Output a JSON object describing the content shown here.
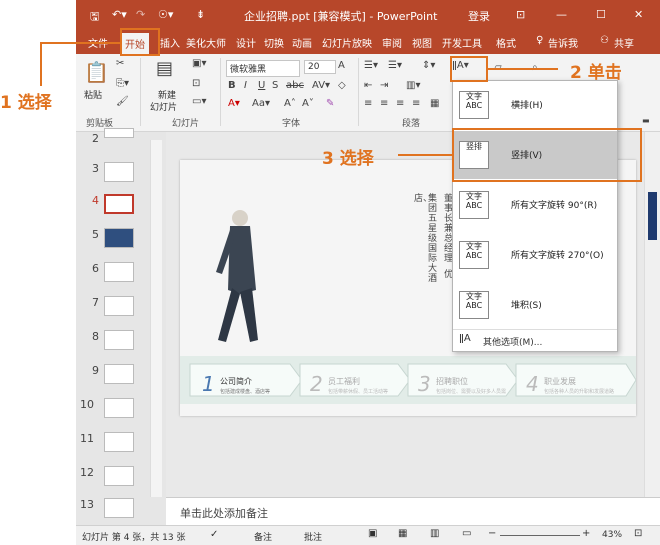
{
  "app": {
    "title": "企业招聘.ppt [兼容模式] - PowerPoint",
    "login": "登录"
  },
  "menu": {
    "tabs": [
      "文件",
      "开始",
      "插入",
      "美化大师",
      "设计",
      "切换",
      "动画",
      "幻灯片放映",
      "审阅",
      "视图",
      "开发工具",
      "格式"
    ],
    "tell_me": "告诉我",
    "share": "共享"
  },
  "ribbon": {
    "paste": "粘贴",
    "new_slide_1": "新建",
    "new_slide_2": "幻灯片",
    "font_name": "微软雅黑",
    "font_size": "20",
    "groups": [
      "剪贴板",
      "幻灯片",
      "字体",
      "段落"
    ]
  },
  "dropdown": {
    "items": [
      {
        "icon_text": "文字ABC",
        "label": "横排(H)"
      },
      {
        "icon_text": "竖排",
        "label": "竖排(V)"
      },
      {
        "icon_text": "文字ABC",
        "label": "所有文字旋转 90°(R)"
      },
      {
        "icon_text": "文字ABC",
        "label": "所有文字旋转 270°(O)"
      },
      {
        "icon_text": "文字ABC",
        "label": "堆积(S)"
      }
    ],
    "more": "其他选项(M)..."
  },
  "callouts": {
    "c1": "1 选择",
    "c2": "2 单击",
    "c3": "3 选择"
  },
  "slides": {
    "numbers": [
      "2",
      "3",
      "4",
      "5",
      "6",
      "7",
      "8",
      "9",
      "10",
      "11",
      "12",
      "13"
    ],
    "selected": "4"
  },
  "slide": {
    "vertical_text": [
      "店、",
      "集团五星级国际大酒",
      "董事长兼总经理",
      "优",
      "集团"
    ],
    "steps": [
      {
        "num": "1",
        "title": "公司简介",
        "sub": "包括建成楼盘、酒店等"
      },
      {
        "num": "2",
        "title": "员工福利",
        "sub": "包括带薪休假、员工活动等"
      },
      {
        "num": "3",
        "title": "招聘职位",
        "sub": "包括岗位、需要以及好多人员需"
      },
      {
        "num": "4",
        "title": "职业发展",
        "sub": "包括各种人员的升职和发展道路"
      }
    ]
  },
  "notes": "单击此处添加备注",
  "status": {
    "slide_info": "幻灯片 第 4 张，共 13 张",
    "notes_btn": "备注",
    "comments_btn": "批注",
    "zoom": "43%"
  },
  "colors": {
    "accent": "#b7472a",
    "callout": "#e07320"
  }
}
